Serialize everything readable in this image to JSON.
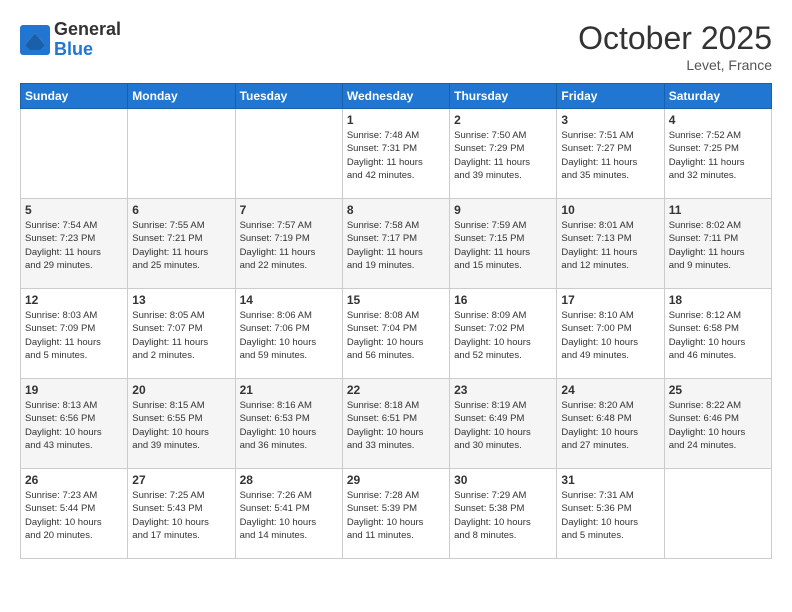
{
  "header": {
    "logo_general": "General",
    "logo_blue": "Blue",
    "month": "October 2025",
    "location": "Levet, France"
  },
  "days_of_week": [
    "Sunday",
    "Monday",
    "Tuesday",
    "Wednesday",
    "Thursday",
    "Friday",
    "Saturday"
  ],
  "weeks": [
    [
      {
        "day": "",
        "info": ""
      },
      {
        "day": "",
        "info": ""
      },
      {
        "day": "",
        "info": ""
      },
      {
        "day": "1",
        "info": "Sunrise: 7:48 AM\nSunset: 7:31 PM\nDaylight: 11 hours\nand 42 minutes."
      },
      {
        "day": "2",
        "info": "Sunrise: 7:50 AM\nSunset: 7:29 PM\nDaylight: 11 hours\nand 39 minutes."
      },
      {
        "day": "3",
        "info": "Sunrise: 7:51 AM\nSunset: 7:27 PM\nDaylight: 11 hours\nand 35 minutes."
      },
      {
        "day": "4",
        "info": "Sunrise: 7:52 AM\nSunset: 7:25 PM\nDaylight: 11 hours\nand 32 minutes."
      }
    ],
    [
      {
        "day": "5",
        "info": "Sunrise: 7:54 AM\nSunset: 7:23 PM\nDaylight: 11 hours\nand 29 minutes."
      },
      {
        "day": "6",
        "info": "Sunrise: 7:55 AM\nSunset: 7:21 PM\nDaylight: 11 hours\nand 25 minutes."
      },
      {
        "day": "7",
        "info": "Sunrise: 7:57 AM\nSunset: 7:19 PM\nDaylight: 11 hours\nand 22 minutes."
      },
      {
        "day": "8",
        "info": "Sunrise: 7:58 AM\nSunset: 7:17 PM\nDaylight: 11 hours\nand 19 minutes."
      },
      {
        "day": "9",
        "info": "Sunrise: 7:59 AM\nSunset: 7:15 PM\nDaylight: 11 hours\nand 15 minutes."
      },
      {
        "day": "10",
        "info": "Sunrise: 8:01 AM\nSunset: 7:13 PM\nDaylight: 11 hours\nand 12 minutes."
      },
      {
        "day": "11",
        "info": "Sunrise: 8:02 AM\nSunset: 7:11 PM\nDaylight: 11 hours\nand 9 minutes."
      }
    ],
    [
      {
        "day": "12",
        "info": "Sunrise: 8:03 AM\nSunset: 7:09 PM\nDaylight: 11 hours\nand 5 minutes."
      },
      {
        "day": "13",
        "info": "Sunrise: 8:05 AM\nSunset: 7:07 PM\nDaylight: 11 hours\nand 2 minutes."
      },
      {
        "day": "14",
        "info": "Sunrise: 8:06 AM\nSunset: 7:06 PM\nDaylight: 10 hours\nand 59 minutes."
      },
      {
        "day": "15",
        "info": "Sunrise: 8:08 AM\nSunset: 7:04 PM\nDaylight: 10 hours\nand 56 minutes."
      },
      {
        "day": "16",
        "info": "Sunrise: 8:09 AM\nSunset: 7:02 PM\nDaylight: 10 hours\nand 52 minutes."
      },
      {
        "day": "17",
        "info": "Sunrise: 8:10 AM\nSunset: 7:00 PM\nDaylight: 10 hours\nand 49 minutes."
      },
      {
        "day": "18",
        "info": "Sunrise: 8:12 AM\nSunset: 6:58 PM\nDaylight: 10 hours\nand 46 minutes."
      }
    ],
    [
      {
        "day": "19",
        "info": "Sunrise: 8:13 AM\nSunset: 6:56 PM\nDaylight: 10 hours\nand 43 minutes."
      },
      {
        "day": "20",
        "info": "Sunrise: 8:15 AM\nSunset: 6:55 PM\nDaylight: 10 hours\nand 39 minutes."
      },
      {
        "day": "21",
        "info": "Sunrise: 8:16 AM\nSunset: 6:53 PM\nDaylight: 10 hours\nand 36 minutes."
      },
      {
        "day": "22",
        "info": "Sunrise: 8:18 AM\nSunset: 6:51 PM\nDaylight: 10 hours\nand 33 minutes."
      },
      {
        "day": "23",
        "info": "Sunrise: 8:19 AM\nSunset: 6:49 PM\nDaylight: 10 hours\nand 30 minutes."
      },
      {
        "day": "24",
        "info": "Sunrise: 8:20 AM\nSunset: 6:48 PM\nDaylight: 10 hours\nand 27 minutes."
      },
      {
        "day": "25",
        "info": "Sunrise: 8:22 AM\nSunset: 6:46 PM\nDaylight: 10 hours\nand 24 minutes."
      }
    ],
    [
      {
        "day": "26",
        "info": "Sunrise: 7:23 AM\nSunset: 5:44 PM\nDaylight: 10 hours\nand 20 minutes."
      },
      {
        "day": "27",
        "info": "Sunrise: 7:25 AM\nSunset: 5:43 PM\nDaylight: 10 hours\nand 17 minutes."
      },
      {
        "day": "28",
        "info": "Sunrise: 7:26 AM\nSunset: 5:41 PM\nDaylight: 10 hours\nand 14 minutes."
      },
      {
        "day": "29",
        "info": "Sunrise: 7:28 AM\nSunset: 5:39 PM\nDaylight: 10 hours\nand 11 minutes."
      },
      {
        "day": "30",
        "info": "Sunrise: 7:29 AM\nSunset: 5:38 PM\nDaylight: 10 hours\nand 8 minutes."
      },
      {
        "day": "31",
        "info": "Sunrise: 7:31 AM\nSunset: 5:36 PM\nDaylight: 10 hours\nand 5 minutes."
      },
      {
        "day": "",
        "info": ""
      }
    ]
  ]
}
